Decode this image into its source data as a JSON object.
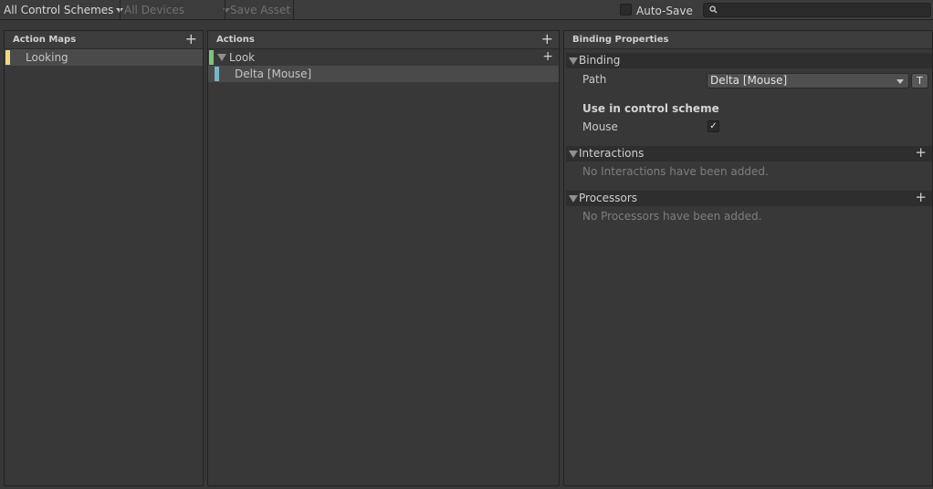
{
  "toolbar": {
    "control_schemes": "All Control Schemes",
    "devices": "All Devices",
    "save_asset": "Save Asset",
    "auto_save_label": "Auto-Save",
    "auto_save_checked": false,
    "search_placeholder": ""
  },
  "action_maps": {
    "header": "Action Maps",
    "add_icon": "plus-icon",
    "items": [
      {
        "label": "Looking",
        "selected": true,
        "color": "#f0d87c"
      }
    ]
  },
  "actions": {
    "header": "Actions",
    "add_icon": "plus-icon",
    "items": [
      {
        "label": "Look",
        "color": "#7ec27e",
        "expanded": true
      },
      {
        "label": "Delta [Mouse]",
        "color": "#79b6c4",
        "selected": true
      }
    ]
  },
  "binding_properties": {
    "header": "Binding Properties",
    "binding": {
      "section_label": "Binding",
      "path_label": "Path",
      "path_value": "Delta [Mouse]",
      "t_button": "T",
      "control_scheme_title": "Use in control scheme",
      "schemes": [
        {
          "label": "Mouse",
          "checked": true
        }
      ]
    },
    "interactions": {
      "section_label": "Interactions",
      "empty_message": "No Interactions have been added."
    },
    "processors": {
      "section_label": "Processors",
      "empty_message": "No Processors have been added."
    }
  },
  "colors": {
    "background": "#383838",
    "header": "#3c3c3c",
    "selection": "#4a4a4a"
  }
}
